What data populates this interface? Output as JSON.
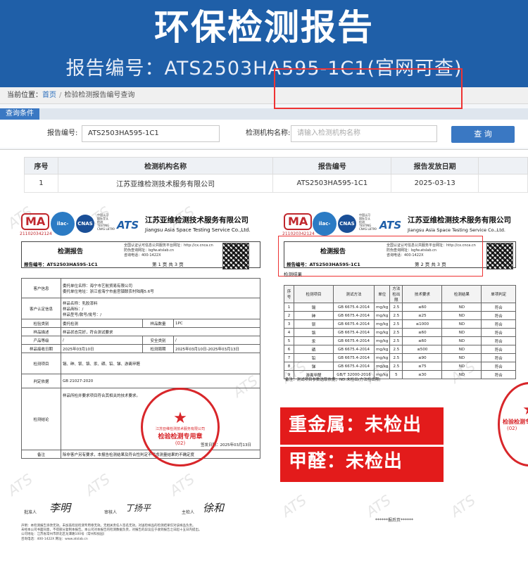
{
  "banner": {
    "title": "环保检测报告",
    "subtitle": "报告编号：ATS2503HA595-1C1(官网可查)"
  },
  "site": {
    "breadcrumb_prefix": "当前位置：",
    "breadcrumb_home": "首页",
    "breadcrumb_sep": "/",
    "breadcrumb_current": "检验检测报告编号查询",
    "condition_tab": "查询条件",
    "report_no_label": "报告编号:",
    "report_no_value": "ATS2503HA595-1C1",
    "agency_label": "检测机构名称:",
    "agency_placeholder": "请输入检测机构名称",
    "query_button": "查 询",
    "columns": [
      "序号",
      "检测机构名称",
      "报告编号",
      "报告发放日期"
    ],
    "rows": [
      [
        "1",
        "江苏亚维检测技术服务有限公司",
        "ATS2503HA595-1C1",
        "2025-03-13"
      ]
    ]
  },
  "report_common": {
    "ma_logo": "MA",
    "ma_no": "211020342124",
    "ilac_logo": "ilac-MRA",
    "cnas_logo": "CNAS",
    "lab_text_1": "中国认可",
    "lab_text_2": "国际互认",
    "lab_text_3": "检测",
    "lab_text_4": "TESTING",
    "lab_text_5": "CNAS L8799",
    "ats_logo": "ATS",
    "company_cn": "江苏亚维检测技术服务有限公司",
    "company_en": "Jiangsu Asia Space Testing Service Co.,Ltd.",
    "report_title": "检测报告",
    "verify_1": "全国认证认可信息公共服务平台网址：http://cx.cnca.cn",
    "verify_2": "防伪查询网址：bgfw.atslab.cn",
    "verify_3": "咨询电话：400-1422X",
    "report_no": "报告编号：ATS2503HA595-1C1",
    "watermark": "ATS"
  },
  "report_left": {
    "page": "第 1 页 共 3 页",
    "client_label": "客户信息",
    "client_name": "委托单位名称：海宁市艺航贸易有限公司",
    "client_addr": "委托单位地址：浙江省海宁市盐官镇联农村陆庵5.6号",
    "sample_label": "客户认定信息",
    "sample_name": "样品名称：乳胶漆料",
    "sample_brand": "样品商标：/",
    "sample_model": "样品型号/款号/批号：/",
    "type_label": "检验类别",
    "type_value": "委托检测",
    "qty_label": "样品数量",
    "qty_value": "1PC",
    "desc_label": "样品描述",
    "desc_value": "样品状态完好，符合测试要求",
    "grade_label": "产品等级",
    "grade_value": "/",
    "safety_label": "安全类别",
    "safety_value": "/",
    "recv_label": "样品接收日期",
    "recv_value": "2025年03月10日",
    "period_label": "检测周期",
    "period_value": "2025年03月10日-2025年03月13日",
    "items_label": "检测项目",
    "items_value": "镉、砷、钡、铬、汞、硒、铅、锑、游离甲醛",
    "std_label": "判定依据",
    "std_value": "GB 21027-2020",
    "concl_label": "检测结论",
    "concl_value": "样品所检并要求项目符合其相关的技术要求。",
    "stamp_text": "检验检测专用章",
    "stamp_no": "(02)",
    "sign_date": "签发日期：2025年03月13日",
    "remark_label": "备注",
    "remark_value": "除非客户另有要求，本报告检测结果及符合性判定不考虑测量结果的不确定度",
    "approver_label": "批准人",
    "approver_sig": "李明",
    "reviewer_label": "审核人",
    "reviewer_sig": "丁扬平",
    "tester_label": "主检人",
    "tester_sig": "徐和",
    "footer_1": "声明：本检测报告涂改无效。未加盖检验检测专用章无效。无相关责任人签名无效。对送检样品的检测结果仅对该样品负责。",
    "footer_2": "未经本公司书面同意，不得部分复制本报告。本公司对本报告的检测数据负责，对报告的异议应于收到报告之日起十五日内提出。",
    "footer_3": "公司地址：江苏省常州市新北区龙潭路100号（常州科技园）",
    "footer_4": "咨询电话：400-1422X   网址：www.atslab.cn"
  },
  "report_right": {
    "page": "第 2 页 共 3 页",
    "result_title": "检测结果",
    "columns": [
      "序号",
      "检测项目",
      "测试方法",
      "单位",
      "方法检出限",
      "技术要求",
      "检测结果",
      "单项判定"
    ],
    "rows": [
      [
        "1",
        "镉",
        "GB 6675.4-2014",
        "mg/kg",
        "2.5",
        "≤60",
        "ND",
        "符合"
      ],
      [
        "2",
        "砷",
        "GB 6675.4-2014",
        "mg/kg",
        "2.5",
        "≤25",
        "ND",
        "符合"
      ],
      [
        "3",
        "钡",
        "GB 6675.4-2014",
        "mg/kg",
        "2.5",
        "≤1000",
        "ND",
        "符合"
      ],
      [
        "4",
        "铬",
        "GB 6675.4-2014",
        "mg/kg",
        "2.5",
        "≤60",
        "ND",
        "符合"
      ],
      [
        "5",
        "汞",
        "GB 6675.4-2014",
        "mg/kg",
        "2.5",
        "≤60",
        "ND",
        "符合"
      ],
      [
        "6",
        "硒",
        "GB 6675.4-2014",
        "mg/kg",
        "2.5",
        "≤500",
        "ND",
        "符合"
      ],
      [
        "7",
        "铅",
        "GB 6675.4-2014",
        "mg/kg",
        "2.5",
        "≤90",
        "ND",
        "符合"
      ],
      [
        "8",
        "锑",
        "GB 6675.4-2014",
        "mg/kg",
        "2.5",
        "≤75",
        "ND",
        "符合"
      ],
      [
        "9",
        "游离甲醛",
        "GB/T 32000-2016",
        "mg/kg",
        "5",
        "≤30",
        "ND",
        "符合"
      ]
    ],
    "note": "备注：测试项目参数选取依据；ND:未检出(方法检出限)",
    "end_mark": "******报后页******"
  },
  "callout": {
    "line1": "重金属：未检出",
    "line2": "甲醛：未检出"
  },
  "colors": {
    "banner": "#1f5fa8",
    "highlight": "#e33333",
    "callout": "#e31b1b",
    "stamp": "#d8262a"
  }
}
